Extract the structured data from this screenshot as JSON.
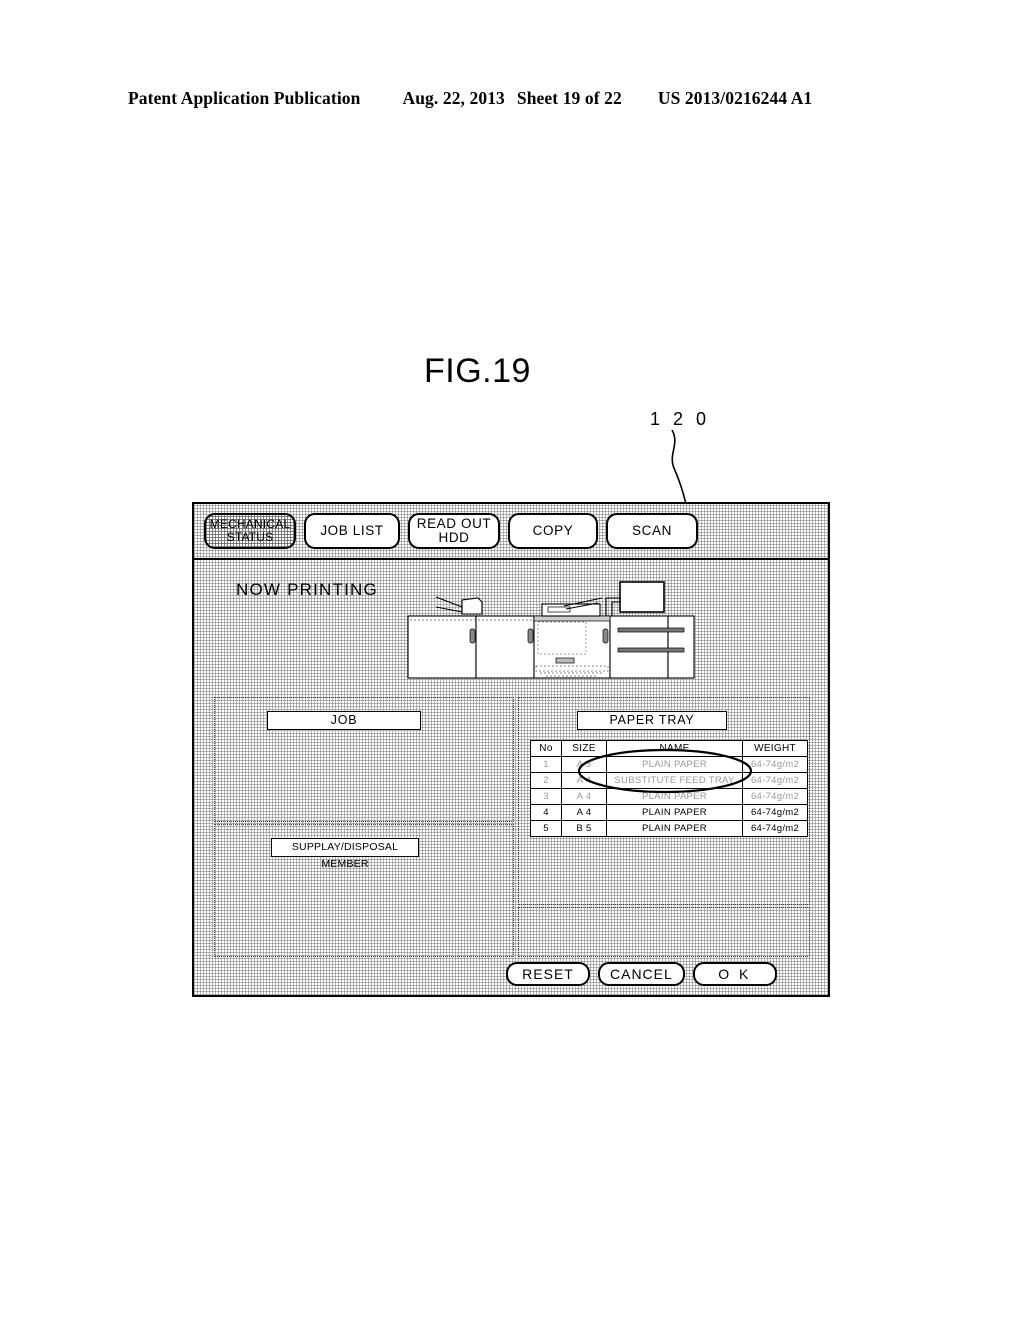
{
  "patent_header": {
    "publication": "Patent Application Publication",
    "date": "Aug. 22, 2013",
    "sheet": "Sheet 19 of 22",
    "number": "US 2013/0216244 A1"
  },
  "figure": {
    "title": "FIG.19",
    "reference_numeral": "1 2 0"
  },
  "console": {
    "tabs": [
      {
        "label_line1": "MECHANICAL",
        "label_line2": "STATUS",
        "selected": true
      },
      {
        "label_line1": "JOB LIST",
        "label_line2": "",
        "selected": false
      },
      {
        "label_line1": "READ OUT",
        "label_line2": "HDD",
        "selected": false
      },
      {
        "label_line1": "COPY",
        "label_line2": "",
        "selected": false
      },
      {
        "label_line1": "SCAN",
        "label_line2": "",
        "selected": false
      }
    ],
    "status_text": "NOW PRINTING",
    "panels": {
      "job_title": "JOB",
      "supply_title": "SUPPLAY/DISPOSAL MEMBER",
      "paper_tray_title": "PAPER TRAY"
    },
    "paper_tray_table": {
      "columns": [
        "No",
        "SIZE",
        "NAME",
        "WEIGHT"
      ],
      "rows": [
        {
          "no": "1",
          "size": "A 3",
          "name": "PLAIN PAPER",
          "weight": "64-74g/m2",
          "faint": true
        },
        {
          "no": "2",
          "size": "A 4",
          "name": "SUBSTITUTE FEED TRAY",
          "weight": "64-74g/m2",
          "faint": true
        },
        {
          "no": "3",
          "size": "A 4",
          "name": "PLAIN PAPER",
          "weight": "64-74g/m2",
          "faint": true
        },
        {
          "no": "4",
          "size": "A 4",
          "name": "PLAIN PAPER",
          "weight": "64-74g/m2",
          "faint": false
        },
        {
          "no": "5",
          "size": "B 5",
          "name": "PLAIN PAPER",
          "weight": "64-74g/m2",
          "faint": false
        }
      ],
      "annotation": "ellipse highlighting rows 1-3 around SUBSTITUTE FEED TRAY"
    },
    "actions": [
      {
        "label": "RESET"
      },
      {
        "label": "CANCEL"
      },
      {
        "label": "O K"
      }
    ]
  },
  "colors": {
    "ink": "#000000",
    "stipple": "#787878",
    "faint_text": "#9a9a9a"
  }
}
